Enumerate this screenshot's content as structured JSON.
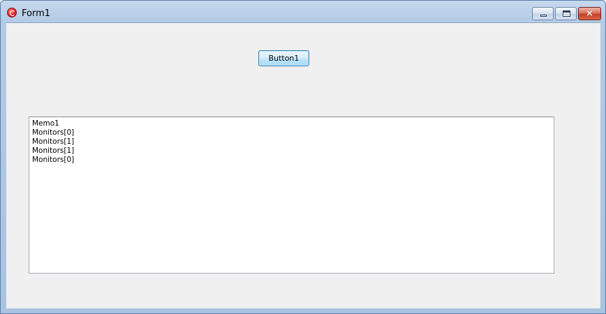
{
  "window": {
    "title": "Form1",
    "icon": "app-icon-red-circle",
    "caption_buttons": {
      "minimize": "minimize-icon",
      "maximize": "maximize-icon",
      "close": "×"
    },
    "colors": {
      "frame": "#b4cbe5",
      "client": "#f0f0f0",
      "close_button": "#c3412a"
    }
  },
  "form": {
    "button1_label": "Button1",
    "memo": {
      "lines": [
        "Memo1",
        "Monitors[0]",
        "Monitors[1]",
        "Monitors[1]",
        "Monitors[0]"
      ]
    }
  }
}
